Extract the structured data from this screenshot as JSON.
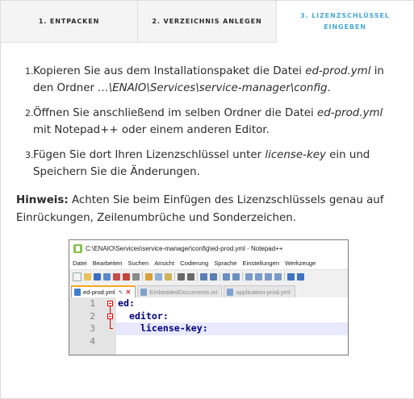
{
  "tabs": [
    {
      "label": "1. ENTPACKEN"
    },
    {
      "label": "2. VERZEICHNIS ANLEGEN"
    },
    {
      "label": "3. LIZENZSCHLÜSSEL EINGEBEN"
    }
  ],
  "steps": [
    {
      "number": "1.",
      "text_a": "Kopieren Sie aus dem Installationspaket die Datei ",
      "file": "ed-prod.yml",
      "text_b": " in den Ordner ",
      "folder": "…\\ENAIO\\Services\\service-manager\\config",
      "text_c": "."
    },
    {
      "number": "2.",
      "text_a": "Öffnen Sie anschließend im selben Ordner die Datei ",
      "file": "ed-prod.yml",
      "text_b": " mit Notepad++ oder einem anderen Editor."
    },
    {
      "number": "3.",
      "text_a": "Fügen Sie dort Ihren Lizenzschlüssel unter ",
      "key": "license-key",
      "text_b": " ein und Speichern Sie die Änderungen."
    }
  ],
  "hint": {
    "label": "Hinweis:",
    "text": " Achten Sie beim Einfügen des Lizenzschlüssels genau auf Einrückungen, Zeilenumbrüche und Sonderzeichen."
  },
  "notepad": {
    "title": "C:\\ENAIO\\Services\\service-manager\\config\\ed-prod.yml - Notepad++",
    "menu": [
      "Datei",
      "Bearbeiten",
      "Suchen",
      "Ansicht",
      "Codierung",
      "Sprache",
      "Einstellungen",
      "Werkzeuge"
    ],
    "tabs": [
      {
        "label": "ed-prod.yml",
        "active": true
      },
      {
        "label": "EmbeddedDocuments.txt",
        "active": false
      },
      {
        "label": "application-prod.yml",
        "active": false
      }
    ],
    "line_numbers": [
      "1",
      "2",
      "3",
      "4"
    ],
    "code_lines": [
      "ed:",
      "  editor:",
      "    license-key:",
      ""
    ],
    "colors": {
      "code": "#000080",
      "current_line": "#e8e8ff",
      "gutter": "#e4e4e4",
      "fold_marker": "#dd0000",
      "active_tab_accent": "#f5a623"
    }
  },
  "colors": {
    "active_tab_text": "#4aa9d8",
    "tab_bg": "#f4f4f4"
  }
}
